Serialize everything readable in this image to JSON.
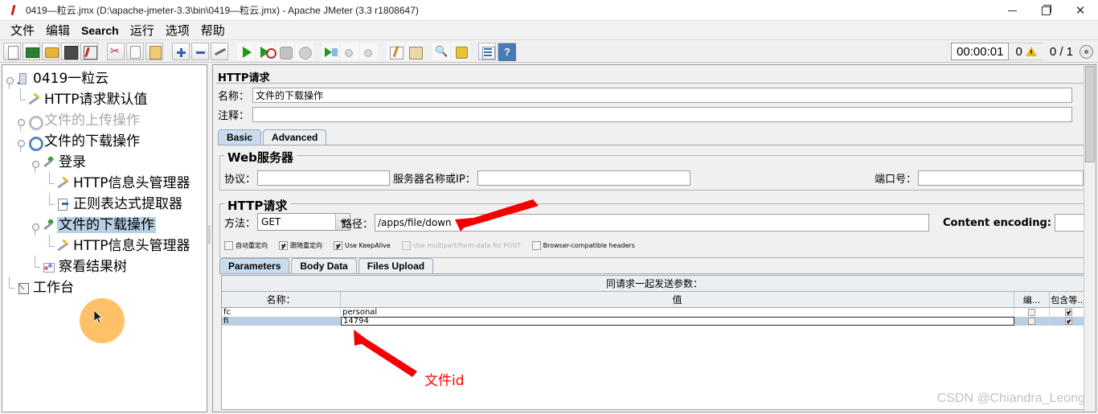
{
  "window": {
    "title": "0419—粒云.jmx (D:\\apache-jmeter-3.3\\bin\\0419—粒云.jmx) - Apache JMeter (3.3 r1808647)",
    "minimize": "—",
    "maximize": "❐",
    "close": "✕"
  },
  "menu": {
    "items": [
      {
        "label": "文件"
      },
      {
        "label": "编辑"
      },
      {
        "label": "Search"
      },
      {
        "label": "运行"
      },
      {
        "label": "选项"
      },
      {
        "label": "帮助"
      }
    ]
  },
  "toolbar": {
    "icons": [
      "new-document-icon",
      "open-templates-icon",
      "open-file-icon",
      "save-icon",
      "save-as-icon",
      "cut-icon",
      "copy-icon",
      "paste-icon",
      "expand-all-icon",
      "collapse-all-icon",
      "toggle-icon",
      "start-icon",
      "start-no-timers-icon",
      "stop-icon",
      "shutdown-icon",
      "remote-start-all-icon",
      "remote-stop-all-icon",
      "remote-shutdown-all-icon",
      "clear-icon",
      "clear-all-icon",
      "search-icon",
      "search-reset-icon",
      "function-helper-icon",
      "help-icon"
    ]
  },
  "status": {
    "elapsed": "00:00:01",
    "warnings": "0",
    "threads": "0 / 1"
  },
  "tree": {
    "nodes": [
      {
        "label": "0419一粒云",
        "icon": "test-plan-icon",
        "depth": 0,
        "state": "normal"
      },
      {
        "label": "HTTP请求默认值",
        "icon": "wrench-icon",
        "depth": 1,
        "state": "normal"
      },
      {
        "label": "文件的上传操作",
        "icon": "thread-group-icon",
        "depth": 1,
        "state": "disabled"
      },
      {
        "label": "文件的下载操作",
        "icon": "thread-group-icon",
        "depth": 1,
        "state": "normal"
      },
      {
        "label": "登录",
        "icon": "http-sampler-icon",
        "depth": 2,
        "state": "normal"
      },
      {
        "label": "HTTP信息头管理器",
        "icon": "wrench-icon",
        "depth": 3,
        "state": "normal"
      },
      {
        "label": "正则表达式提取器",
        "icon": "regex-extractor-icon",
        "depth": 3,
        "state": "normal"
      },
      {
        "label": "文件的下载操作",
        "icon": "http-sampler-icon",
        "depth": 2,
        "state": "selected"
      },
      {
        "label": "HTTP信息头管理器",
        "icon": "wrench-icon",
        "depth": 3,
        "state": "normal"
      },
      {
        "label": "察看结果树",
        "icon": "view-results-tree-icon",
        "depth": 2,
        "state": "normal"
      },
      {
        "label": "工作台",
        "icon": "workbench-icon",
        "depth": 0,
        "state": "normal"
      }
    ]
  },
  "panel": {
    "title": "HTTP请求",
    "name_label": "名称：",
    "name_value": "文件的下载操作",
    "comment_label": "注释：",
    "comment_value": "",
    "tabs": [
      {
        "label": "Basic",
        "active": true
      },
      {
        "label": "Advanced",
        "active": false
      }
    ],
    "webserver": {
      "title": "Web服务器",
      "protocol_label": "协议：",
      "protocol_value": "",
      "server_label": "服务器名称或IP：",
      "server_value": "",
      "port_label": "端口号：",
      "port_value": ""
    },
    "httprequest": {
      "title": "HTTP请求",
      "method_label": "方法：",
      "method_value": "GET",
      "path_label": "路径：",
      "path_value": "/apps/file/down",
      "content_encoding_label": "Content encoding:",
      "content_encoding_value": ""
    },
    "options": [
      {
        "label": "自动重定向",
        "checked": false,
        "disabled": false
      },
      {
        "label": "跟随重定向",
        "checked": true,
        "disabled": false
      },
      {
        "label": "Use KeepAlive",
        "checked": true,
        "disabled": false
      },
      {
        "label": "Use multipart/form-data for POST",
        "checked": false,
        "disabled": true
      },
      {
        "label": "Browser-compatible headers",
        "checked": false,
        "disabled": false
      }
    ],
    "param_tabs": [
      {
        "label": "Parameters",
        "active": true
      },
      {
        "label": "Body Data",
        "active": false
      },
      {
        "label": "Files Upload",
        "active": false
      }
    ],
    "params_table": {
      "banner": "同请求一起发送参数：",
      "columns": [
        "名称：",
        "值",
        "编...",
        "包含等..."
      ],
      "rows": [
        {
          "name": "fc",
          "value": "personal",
          "encode": false,
          "include_equals": true,
          "selected": false,
          "editing": false
        },
        {
          "name": "fi",
          "value": "14794",
          "encode": false,
          "include_equals": true,
          "selected": true,
          "editing": true
        }
      ]
    }
  },
  "annotations": {
    "label_file_id": "文件id",
    "arrow_color": "#f40000"
  },
  "watermark": "CSDN @Chiandra_Leong"
}
